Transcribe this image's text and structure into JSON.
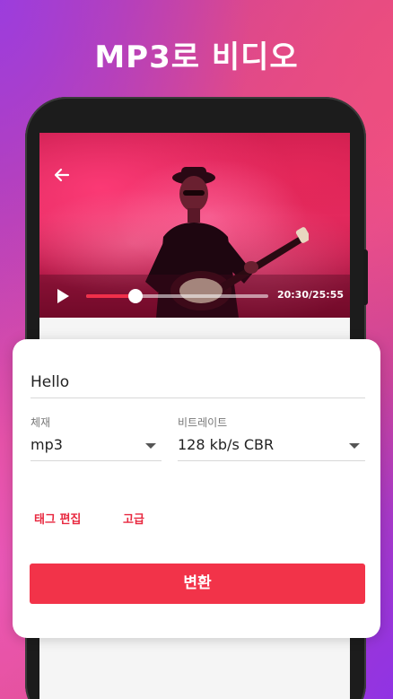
{
  "promo": {
    "title": "MP3로 비디오"
  },
  "player": {
    "back_icon": "arrow-left-icon",
    "play_icon": "play-icon",
    "time": "20:30/25:55",
    "progress": 0.27
  },
  "form": {
    "name_value": "Hello",
    "format_label": "체재",
    "format_value": "mp3",
    "bitrate_label": "비트레이트",
    "bitrate_value": "128 kb/s CBR",
    "edit_tags_label": "태그 편집",
    "advanced_label": "고급",
    "convert_label": "변환"
  },
  "colors": {
    "accent": "#f23349",
    "link": "#e8283f"
  }
}
